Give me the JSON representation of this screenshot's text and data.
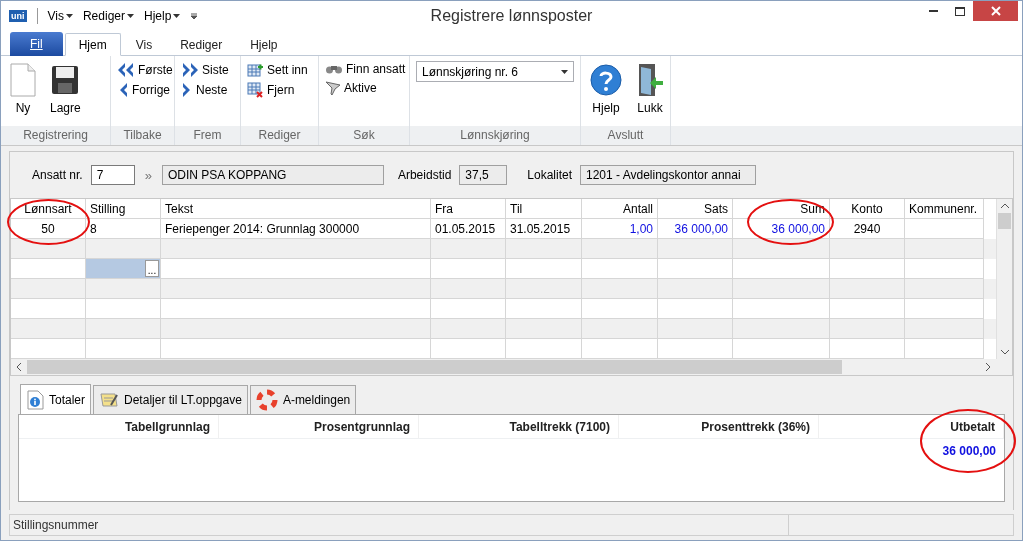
{
  "window": {
    "logo": "uni",
    "menus": [
      "Vis",
      "Rediger",
      "Hjelp"
    ],
    "title": "Registrere lønnsposter"
  },
  "ribbon": {
    "tabs": [
      {
        "label": "Fil",
        "kind": "file",
        "selected": false
      },
      {
        "label": "Hjem",
        "kind": "tab",
        "selected": true
      },
      {
        "label": "Vis",
        "kind": "tab",
        "selected": false
      },
      {
        "label": "Rediger",
        "kind": "tab",
        "selected": false
      },
      {
        "label": "Hjelp",
        "kind": "tab",
        "selected": false
      }
    ],
    "groups": [
      {
        "label": "Registrering",
        "items": [
          {
            "kind": "large",
            "label": "Ny"
          },
          {
            "kind": "large",
            "label": "Lagre"
          }
        ]
      },
      {
        "label": "Tilbake",
        "items": [
          {
            "kind": "small",
            "label": "Første"
          },
          {
            "kind": "small",
            "label": "Forrige"
          }
        ]
      },
      {
        "label": "Frem",
        "items": [
          {
            "kind": "small",
            "label": "Siste"
          },
          {
            "kind": "small",
            "label": "Neste"
          }
        ]
      },
      {
        "label": "Rediger",
        "items": [
          {
            "kind": "small",
            "label": "Sett inn"
          },
          {
            "kind": "small",
            "label": "Fjern"
          }
        ]
      },
      {
        "label": "Søk",
        "items": [
          {
            "kind": "small",
            "label": "Finn ansatt"
          },
          {
            "kind": "small",
            "label": "Aktive"
          }
        ]
      },
      {
        "label": "Lønnskjøring",
        "items": [
          {
            "kind": "dropdown",
            "label": "Lønnskjøring nr. 6"
          }
        ]
      },
      {
        "label": "Avslutt",
        "items": [
          {
            "kind": "large",
            "label": "Hjelp"
          },
          {
            "kind": "large",
            "label": "Lukk"
          }
        ]
      }
    ]
  },
  "employee": {
    "number_label": "Ansatt nr.",
    "number": "7",
    "link": "»",
    "name": "ODIN PSA KOPPANG",
    "hours_label": "Arbeidstid",
    "hours": "37,5",
    "location_label": "Lokalitet",
    "location": "1201 - Avdelingskontor annai"
  },
  "table": {
    "columns": [
      {
        "label": "Lønnsart",
        "kind": "code",
        "circled": true
      },
      {
        "label": "Stilling",
        "kind": "text",
        "circled": false
      },
      {
        "label": "Tekst",
        "kind": "text",
        "circled": false
      },
      {
        "label": "Fra",
        "kind": "text",
        "circled": false
      },
      {
        "label": "Til",
        "kind": "text",
        "circled": false
      },
      {
        "label": "Antall",
        "kind": "amount",
        "circled": false
      },
      {
        "label": "Sats",
        "kind": "amount",
        "circled": false
      },
      {
        "label": "Sum",
        "kind": "amount",
        "circled": true
      },
      {
        "label": "Konto",
        "kind": "code",
        "circled": false
      },
      {
        "label": "Kommunenr.",
        "kind": "text",
        "circled": false
      }
    ],
    "rows": [
      [
        "50",
        "8",
        "Feriepenger 2014: Grunnlag 300000",
        "01.05.2015",
        "31.05.2015",
        "1,00",
        "36 000,00",
        "36 000,00",
        "2940"
      ]
    ],
    "active_cell": {
      "button_label": "..."
    }
  },
  "bottom_tabs": [
    {
      "label": "Totaler",
      "selected": true
    },
    {
      "label": "Detaljer til LT.oppgave",
      "selected": false
    },
    {
      "label": "A-meldingen",
      "selected": false
    }
  ],
  "totals": {
    "columns": [
      {
        "label": "Tabellgrunnlag"
      },
      {
        "label": "Prosentgrunnlag"
      },
      {
        "label": "Tabelltrekk (7100)"
      },
      {
        "label": "Prosenttrekk (36%)"
      },
      {
        "label": "Utbetalt",
        "value": "36 000,00",
        "circled": true
      }
    ]
  },
  "status_bar": {
    "text": "Stillingsnummer"
  }
}
